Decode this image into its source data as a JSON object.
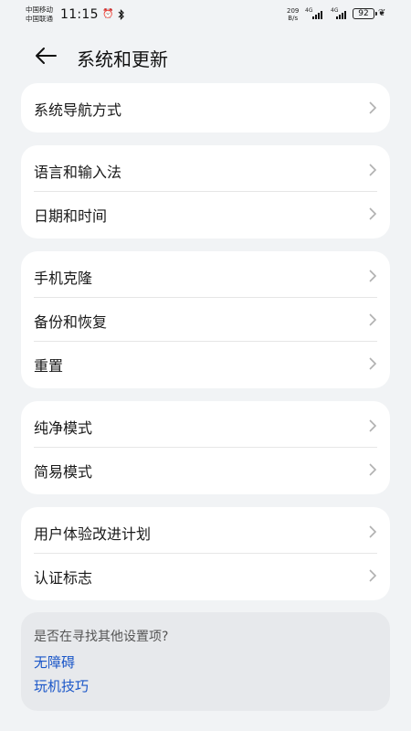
{
  "status_bar": {
    "carrier1": "中国移动",
    "carrier2": "中国联通",
    "time": "11:15",
    "alarm_icon": "alarm-icon",
    "bluetooth_icon": "bluetooth-icon",
    "speed_value": "209",
    "speed_unit": "B/s",
    "network1": "4G",
    "network2": "4G",
    "battery": "92"
  },
  "header": {
    "title": "系统和更新",
    "back_icon": "arrow-left-icon"
  },
  "groups": [
    {
      "items": [
        "系统导航方式"
      ]
    },
    {
      "items": [
        "语言和输入法",
        "日期和时间"
      ]
    },
    {
      "items": [
        "手机克隆",
        "备份和恢复",
        "重置"
      ]
    },
    {
      "items": [
        "纯净模式",
        "简易模式"
      ]
    },
    {
      "items": [
        "用户体验改进计划",
        "认证标志"
      ]
    }
  ],
  "suggestion": {
    "question": "是否在寻找其他设置项?",
    "links": [
      "无障碍",
      "玩机技巧"
    ]
  },
  "colors": {
    "background": "#f1f3f5",
    "card": "#ffffff",
    "link": "#1a56c8",
    "suggestion_bg": "#e7e9ec"
  }
}
